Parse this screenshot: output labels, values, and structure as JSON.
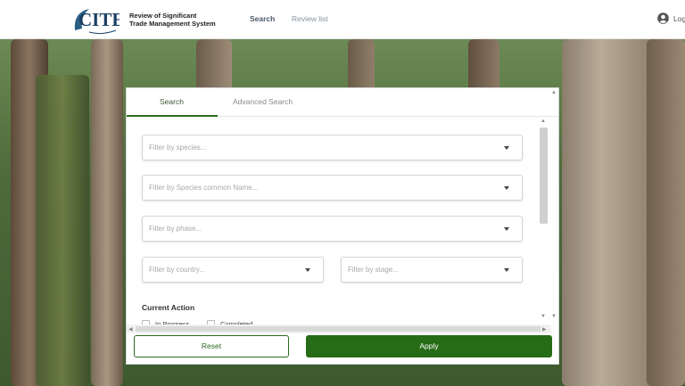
{
  "header": {
    "brand_line1": "Review of Significant",
    "brand_line2": "Trade Management System",
    "nav": {
      "search": "Search",
      "review_list": "Review list"
    },
    "login_label": "Log",
    "logo_text": "CITES"
  },
  "tabs": {
    "search": "Search",
    "advanced": "Advanced Search"
  },
  "filters": {
    "species": "Filter by species...",
    "common_name": "Filter by Species common Name...",
    "phase": "Filter by phase...",
    "country": "Filter by country...",
    "stage": "Filter by stage..."
  },
  "current_action": {
    "title": "Current Action",
    "options": [
      "In Progress",
      "Completed"
    ]
  },
  "buttons": {
    "reset": "Reset",
    "apply": "Apply"
  },
  "colors": {
    "primary_green": "#266b16",
    "tab_active": "#3f5a36"
  }
}
